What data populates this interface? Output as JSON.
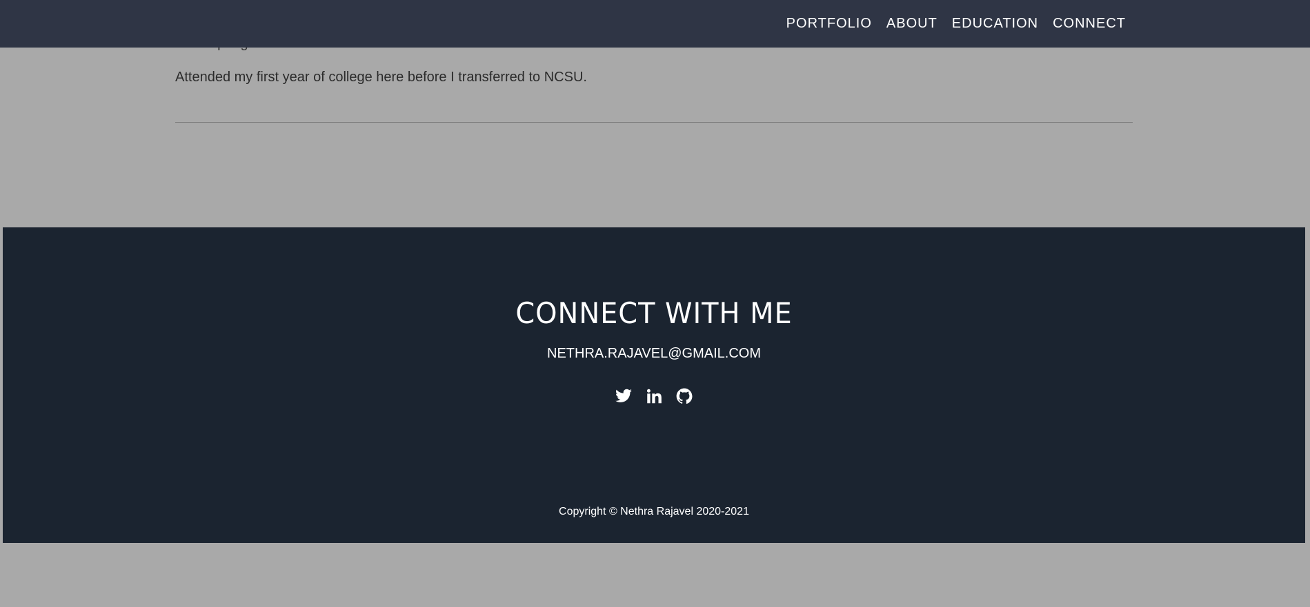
{
  "nav": {
    "items": [
      {
        "label": "PORTFOLIO"
      },
      {
        "label": "ABOUT"
      },
      {
        "label": "EDUCATION"
      },
      {
        "label": "CONNECT"
      }
    ]
  },
  "education": {
    "cut_line": "Date Spring",
    "description": "Attended my first year of college here before I transferred to NCSU."
  },
  "footer": {
    "title": "CONNECT WITH ME",
    "email": "NETHRA.RAJAVEL@GMAIL.COM",
    "social": [
      "twitter-icon",
      "linkedin-icon",
      "github-icon"
    ],
    "copyright": "Copyright © Nethra Rajavel 2020-2021"
  },
  "colors": {
    "page_bg": "#a9a9a9",
    "navbar_bg": "#2f3545",
    "footer_bg": "#1b2430",
    "text_light": "#ffffff"
  }
}
